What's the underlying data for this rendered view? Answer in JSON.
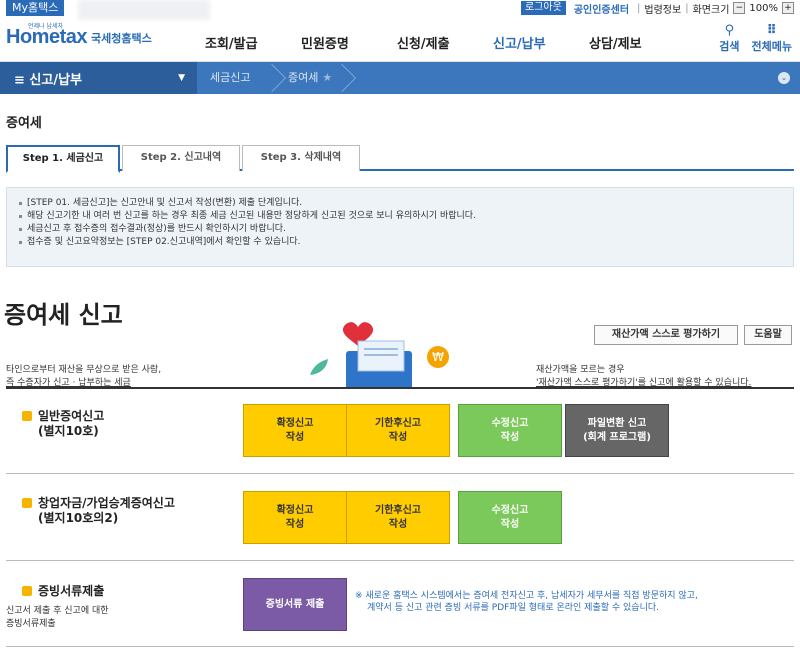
{
  "top": {
    "my_tab": "My홈택스",
    "logout": "로그아웃",
    "cert": "공인인증센터",
    "legal": "법령정보",
    "screen_size": "화면크기",
    "zoom": "100%",
    "minus": "−",
    "plus": "+"
  },
  "header": {
    "logo": "Hometax",
    "logo_sub": "국세청홈택스",
    "logo_tiny": "언제나 납세자",
    "nav": [
      "조회/발급",
      "민원증명",
      "신청/제출",
      "신고/납부",
      "상담/제보"
    ],
    "search": "검색",
    "all_menu": "전체메뉴",
    "search_glyph": "⚲",
    "menu_glyph": "⠿"
  },
  "subnav": {
    "menu": "≡  신고/납부",
    "crumb1": "세금신고",
    "crumb2": "증여세",
    "star": "★",
    "caret": "▼",
    "right": "⌄"
  },
  "page": {
    "title": "증여세",
    "tabs": [
      "Step 1. 세금신고",
      "Step 2. 신고내역",
      "Step 3. 삭제내역"
    ],
    "notices": [
      "[STEP 01. 세금신고]는 신고안내 및 신고서 작성(변환) 제출 단계입니다.",
      "해당 신고기한 내 여러 번 신고를 하는 경우 최종 세금 신고된 내용만 정당하게 신고된 것으로 보니 유의하시기 바랍니다.",
      "세금신고 후 접수증의 접수결과(정상)를 반드시 확인하시기 바랍니다.",
      "접수증 및 신고요약정보는 [STEP 02.신고내역]에서 확인할 수 있습니다."
    ],
    "big_title": "증여세 신고",
    "eval_button": "재산가액 스스로 평가하기",
    "help_button": "도움말",
    "desc_left_1": "타인으로부터 재산을 무상으로 받은 사람,",
    "desc_left_2": "즉 수증자가 신고 · 납부하는 세금",
    "desc_right_1": "재산가액을 모르는 경우",
    "desc_right_2": "'재산가액 스스로 평가하기'를 신고에 활용할 수 있습니다."
  },
  "sections": [
    {
      "title1": "일반증여신고",
      "title2": "(별지10호)",
      "buttons": [
        "확정신고\n작성",
        "기한후신고\n작성",
        "수정신고\n작성",
        "파일변환 신고\n(회계 프로그램)"
      ]
    },
    {
      "title1": "창업자금/가업승계증여신고",
      "title2": "(별지10호의2)",
      "buttons": [
        "확정신고\n작성",
        "기한후신고\n작성",
        "수정신고\n작성"
      ]
    },
    {
      "title1": "증빙서류제출",
      "small1": "신고서 제출 후 신고에 대한",
      "small2": "증빙서류제출",
      "buttons": [
        "증빙서류 제출"
      ],
      "note1": "※ 새로운 홈택스 시스템에서는 증여세 전자신고 후, 납세자가 세무서를 직접 방문하지 않고,",
      "note2": "계약서 등 신고 관련 증빙 서류를 PDF파일 형태로 온라인 제출할 수 있습니다."
    }
  ],
  "colors": {
    "brand": "#2a6bb8",
    "yellow": "#ffcc00",
    "green": "#7bc95a",
    "gray": "#666666",
    "purple": "#7b5aa6"
  }
}
